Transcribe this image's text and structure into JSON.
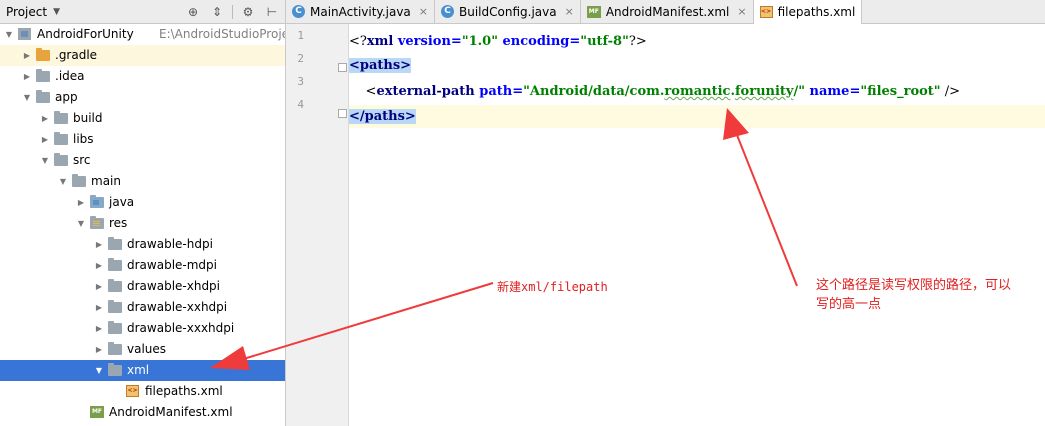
{
  "project_panel": {
    "title": "Project",
    "tree": [
      {
        "label": "AndroidForUnity",
        "sub": "E:\\AndroidStudioProjects\\Ar",
        "indent": 0,
        "arrow": "down",
        "icon": "module"
      },
      {
        "label": ".gradle",
        "indent": 1,
        "arrow": "right",
        "icon": "folder-orange",
        "highlight": "yellow"
      },
      {
        "label": ".idea",
        "indent": 1,
        "arrow": "right",
        "icon": "folder"
      },
      {
        "label": "app",
        "indent": 1,
        "arrow": "down",
        "icon": "folder-app"
      },
      {
        "label": "build",
        "indent": 2,
        "arrow": "right",
        "icon": "folder"
      },
      {
        "label": "libs",
        "indent": 2,
        "arrow": "right",
        "icon": "folder"
      },
      {
        "label": "src",
        "indent": 2,
        "arrow": "down",
        "icon": "folder"
      },
      {
        "label": "main",
        "indent": 3,
        "arrow": "down",
        "icon": "folder"
      },
      {
        "label": "java",
        "indent": 4,
        "arrow": "right",
        "icon": "folder-src"
      },
      {
        "label": "res",
        "indent": 4,
        "arrow": "down",
        "icon": "folder-res"
      },
      {
        "label": "drawable-hdpi",
        "indent": 5,
        "arrow": "right",
        "icon": "folder"
      },
      {
        "label": "drawable-mdpi",
        "indent": 5,
        "arrow": "right",
        "icon": "folder"
      },
      {
        "label": "drawable-xhdpi",
        "indent": 5,
        "arrow": "right",
        "icon": "folder"
      },
      {
        "label": "drawable-xxhdpi",
        "indent": 5,
        "arrow": "right",
        "icon": "folder"
      },
      {
        "label": "drawable-xxxhdpi",
        "indent": 5,
        "arrow": "right",
        "icon": "folder"
      },
      {
        "label": "values",
        "indent": 5,
        "arrow": "right",
        "icon": "folder"
      },
      {
        "label": "xml",
        "indent": 5,
        "arrow": "down",
        "icon": "folder",
        "selected": true
      },
      {
        "label": "filepaths.xml",
        "indent": 6,
        "arrow": "none",
        "icon": "xml-file"
      },
      {
        "label": "AndroidManifest.xml",
        "indent": 4,
        "arrow": "none",
        "icon": "manifest-file"
      }
    ]
  },
  "tabs": [
    {
      "label": "MainActivity.java",
      "icon": "class-icon",
      "active": false
    },
    {
      "label": "BuildConfig.java",
      "icon": "class-icon",
      "active": false
    },
    {
      "label": "AndroidManifest.xml",
      "icon": "manifest-icon",
      "active": false
    },
    {
      "label": "filepaths.xml",
      "icon": "xml-icon",
      "active": true
    }
  ],
  "editor": {
    "line_numbers": [
      "1",
      "2",
      "3",
      "4"
    ],
    "lines": {
      "l1": {
        "open": "<?",
        "name": "xml",
        "a1": " version=",
        "v1": "\"1.0\"",
        "a2": " encoding=",
        "v2": "\"utf-8\"",
        "close": "?>"
      },
      "l2": {
        "text": "<paths>"
      },
      "l3": {
        "indent": "    ",
        "open": "<",
        "name": "external-path",
        "a1": " path=",
        "v1a": "\"Android/data/com.",
        "v1b": "romantic",
        "v1c": ".",
        "v1d": "forunity",
        "v1e": "/\"",
        "a2": " name=",
        "v2": "\"files_root\"",
        "close": " />"
      },
      "l4": {
        "text": "</paths>"
      }
    }
  },
  "annotations": {
    "left": "新建xml/filepath",
    "right_line1": "这个路径是读写权限的路径，可以",
    "right_line2": "写的高一点"
  }
}
